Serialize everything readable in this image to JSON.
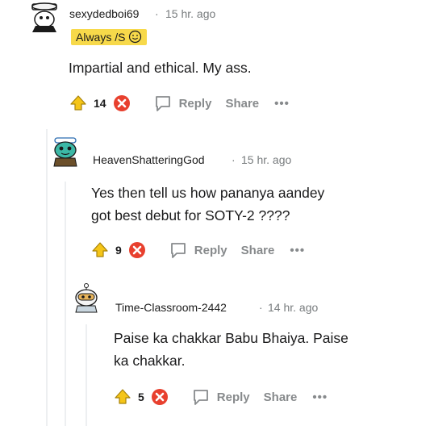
{
  "comments": [
    {
      "username": "sexydedboi69",
      "separator": "·",
      "time": "15 hr. ago",
      "flair": "Always /S",
      "body": [
        "Impartial and ethical. My ass."
      ],
      "score": "14",
      "reply": "Reply",
      "share": "Share",
      "more": "•••"
    },
    {
      "username": "HeavenShatteringGod",
      "separator": "·",
      "time": "15 hr. ago",
      "body": [
        "Yes then tell us how pananya aandey",
        "got best debut for SOTY-2 ????"
      ],
      "score": "9",
      "reply": "Reply",
      "share": "Share",
      "more": "•••"
    },
    {
      "username": "Time-Classroom-2442",
      "separator": "·",
      "time": "14 hr. ago",
      "body": [
        "Paise ka chakkar Babu Bhaiya. Paise",
        "ka chakkar."
      ],
      "score": "5",
      "reply": "Reply",
      "share": "Share",
      "more": "•••"
    }
  ],
  "colors": {
    "upvote": "#f5c518",
    "downvote": "#e8402e",
    "meta": "#787c7e",
    "flair": "#f7d94a"
  },
  "icons": [
    "avatar-icon",
    "upvote-icon",
    "downvote-icon",
    "reply-icon",
    "smiley-icon"
  ]
}
